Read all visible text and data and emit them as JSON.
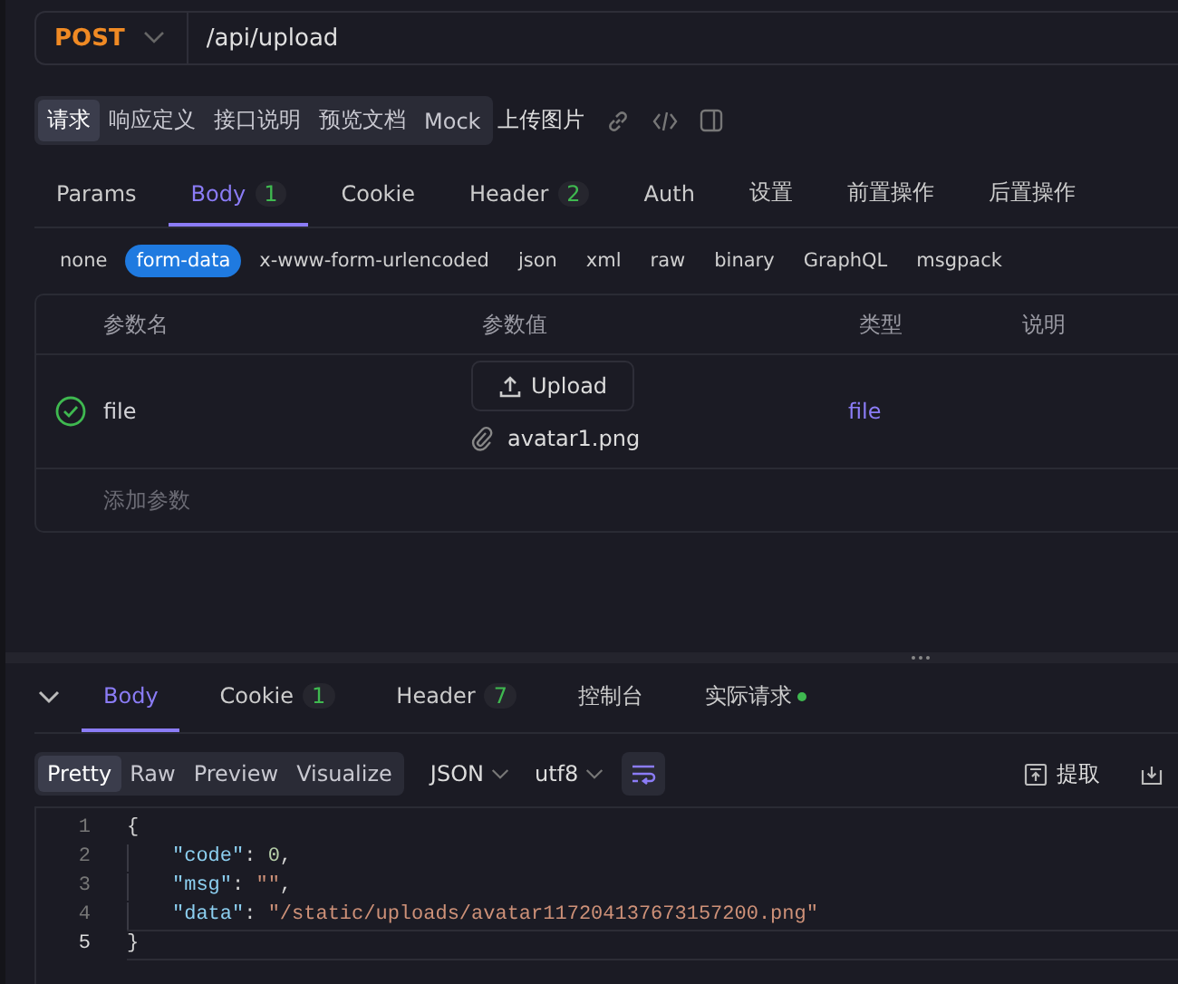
{
  "method": "POST",
  "url": "/api/upload",
  "doc_tabs": [
    {
      "label": "请求",
      "selected": true
    },
    {
      "label": "响应定义",
      "selected": false
    },
    {
      "label": "接口说明",
      "selected": false
    },
    {
      "label": "预览文档",
      "selected": false
    },
    {
      "label": "Mock",
      "selected": false
    }
  ],
  "doc_title": "上传图片",
  "req_tabs": [
    {
      "label": "Params",
      "selected": false
    },
    {
      "label": "Body",
      "badge": "1",
      "selected": true
    },
    {
      "label": "Cookie",
      "selected": false
    },
    {
      "label": "Header",
      "badge": "2",
      "selected": false
    },
    {
      "label": "Auth",
      "selected": false
    },
    {
      "label": "设置",
      "selected": false
    },
    {
      "label": "前置操作",
      "selected": false
    },
    {
      "label": "后置操作",
      "selected": false
    }
  ],
  "body_types": [
    {
      "label": "none",
      "selected": false
    },
    {
      "label": "form-data",
      "selected": true
    },
    {
      "label": "x-www-form-urlencoded",
      "selected": false
    },
    {
      "label": "json",
      "selected": false
    },
    {
      "label": "xml",
      "selected": false
    },
    {
      "label": "raw",
      "selected": false
    },
    {
      "label": "binary",
      "selected": false
    },
    {
      "label": "GraphQL",
      "selected": false
    },
    {
      "label": "msgpack",
      "selected": false
    }
  ],
  "params_table": {
    "columns": [
      "参数名",
      "参数值",
      "类型",
      "说明"
    ],
    "rows": [
      {
        "enabled": true,
        "name": "file",
        "upload_button": "Upload",
        "file_name": "avatar1.png",
        "type": "file"
      }
    ],
    "add_placeholder": "添加参数"
  },
  "resp_tabs": [
    {
      "label": "Body",
      "selected": true
    },
    {
      "label": "Cookie",
      "badge": "1",
      "selected": false
    },
    {
      "label": "Header",
      "badge": "7",
      "selected": false
    },
    {
      "label": "控制台",
      "selected": false
    },
    {
      "label": "实际请求",
      "dot": true,
      "selected": false
    }
  ],
  "view_modes": [
    {
      "label": "Pretty",
      "selected": true
    },
    {
      "label": "Raw",
      "selected": false
    },
    {
      "label": "Preview",
      "selected": false
    },
    {
      "label": "Visualize",
      "selected": false
    }
  ],
  "format": "JSON",
  "encoding": "utf8",
  "extract_button": "提取",
  "code_lines": [
    {
      "number": "1",
      "current": false,
      "indented": false,
      "tokens": [
        {
          "kind": "punct",
          "text": "{"
        }
      ]
    },
    {
      "number": "2",
      "current": false,
      "indented": true,
      "tokens": [
        {
          "kind": "key",
          "text": "\"code\""
        },
        {
          "kind": "punct",
          "text": ": "
        },
        {
          "kind": "num",
          "text": "0"
        },
        {
          "kind": "punct",
          "text": ","
        }
      ]
    },
    {
      "number": "3",
      "current": false,
      "indented": true,
      "tokens": [
        {
          "kind": "key",
          "text": "\"msg\""
        },
        {
          "kind": "punct",
          "text": ": "
        },
        {
          "kind": "str",
          "text": "\"\""
        },
        {
          "kind": "punct",
          "text": ","
        }
      ]
    },
    {
      "number": "4",
      "current": false,
      "indented": true,
      "tokens": [
        {
          "kind": "key",
          "text": "\"data\""
        },
        {
          "kind": "punct",
          "text": ": "
        },
        {
          "kind": "str",
          "text": "\"/static/uploads/avatar117204137673157200.png\""
        }
      ]
    },
    {
      "number": "5",
      "current": true,
      "indented": false,
      "tokens": [
        {
          "kind": "punct",
          "text": "}"
        }
      ]
    }
  ]
}
